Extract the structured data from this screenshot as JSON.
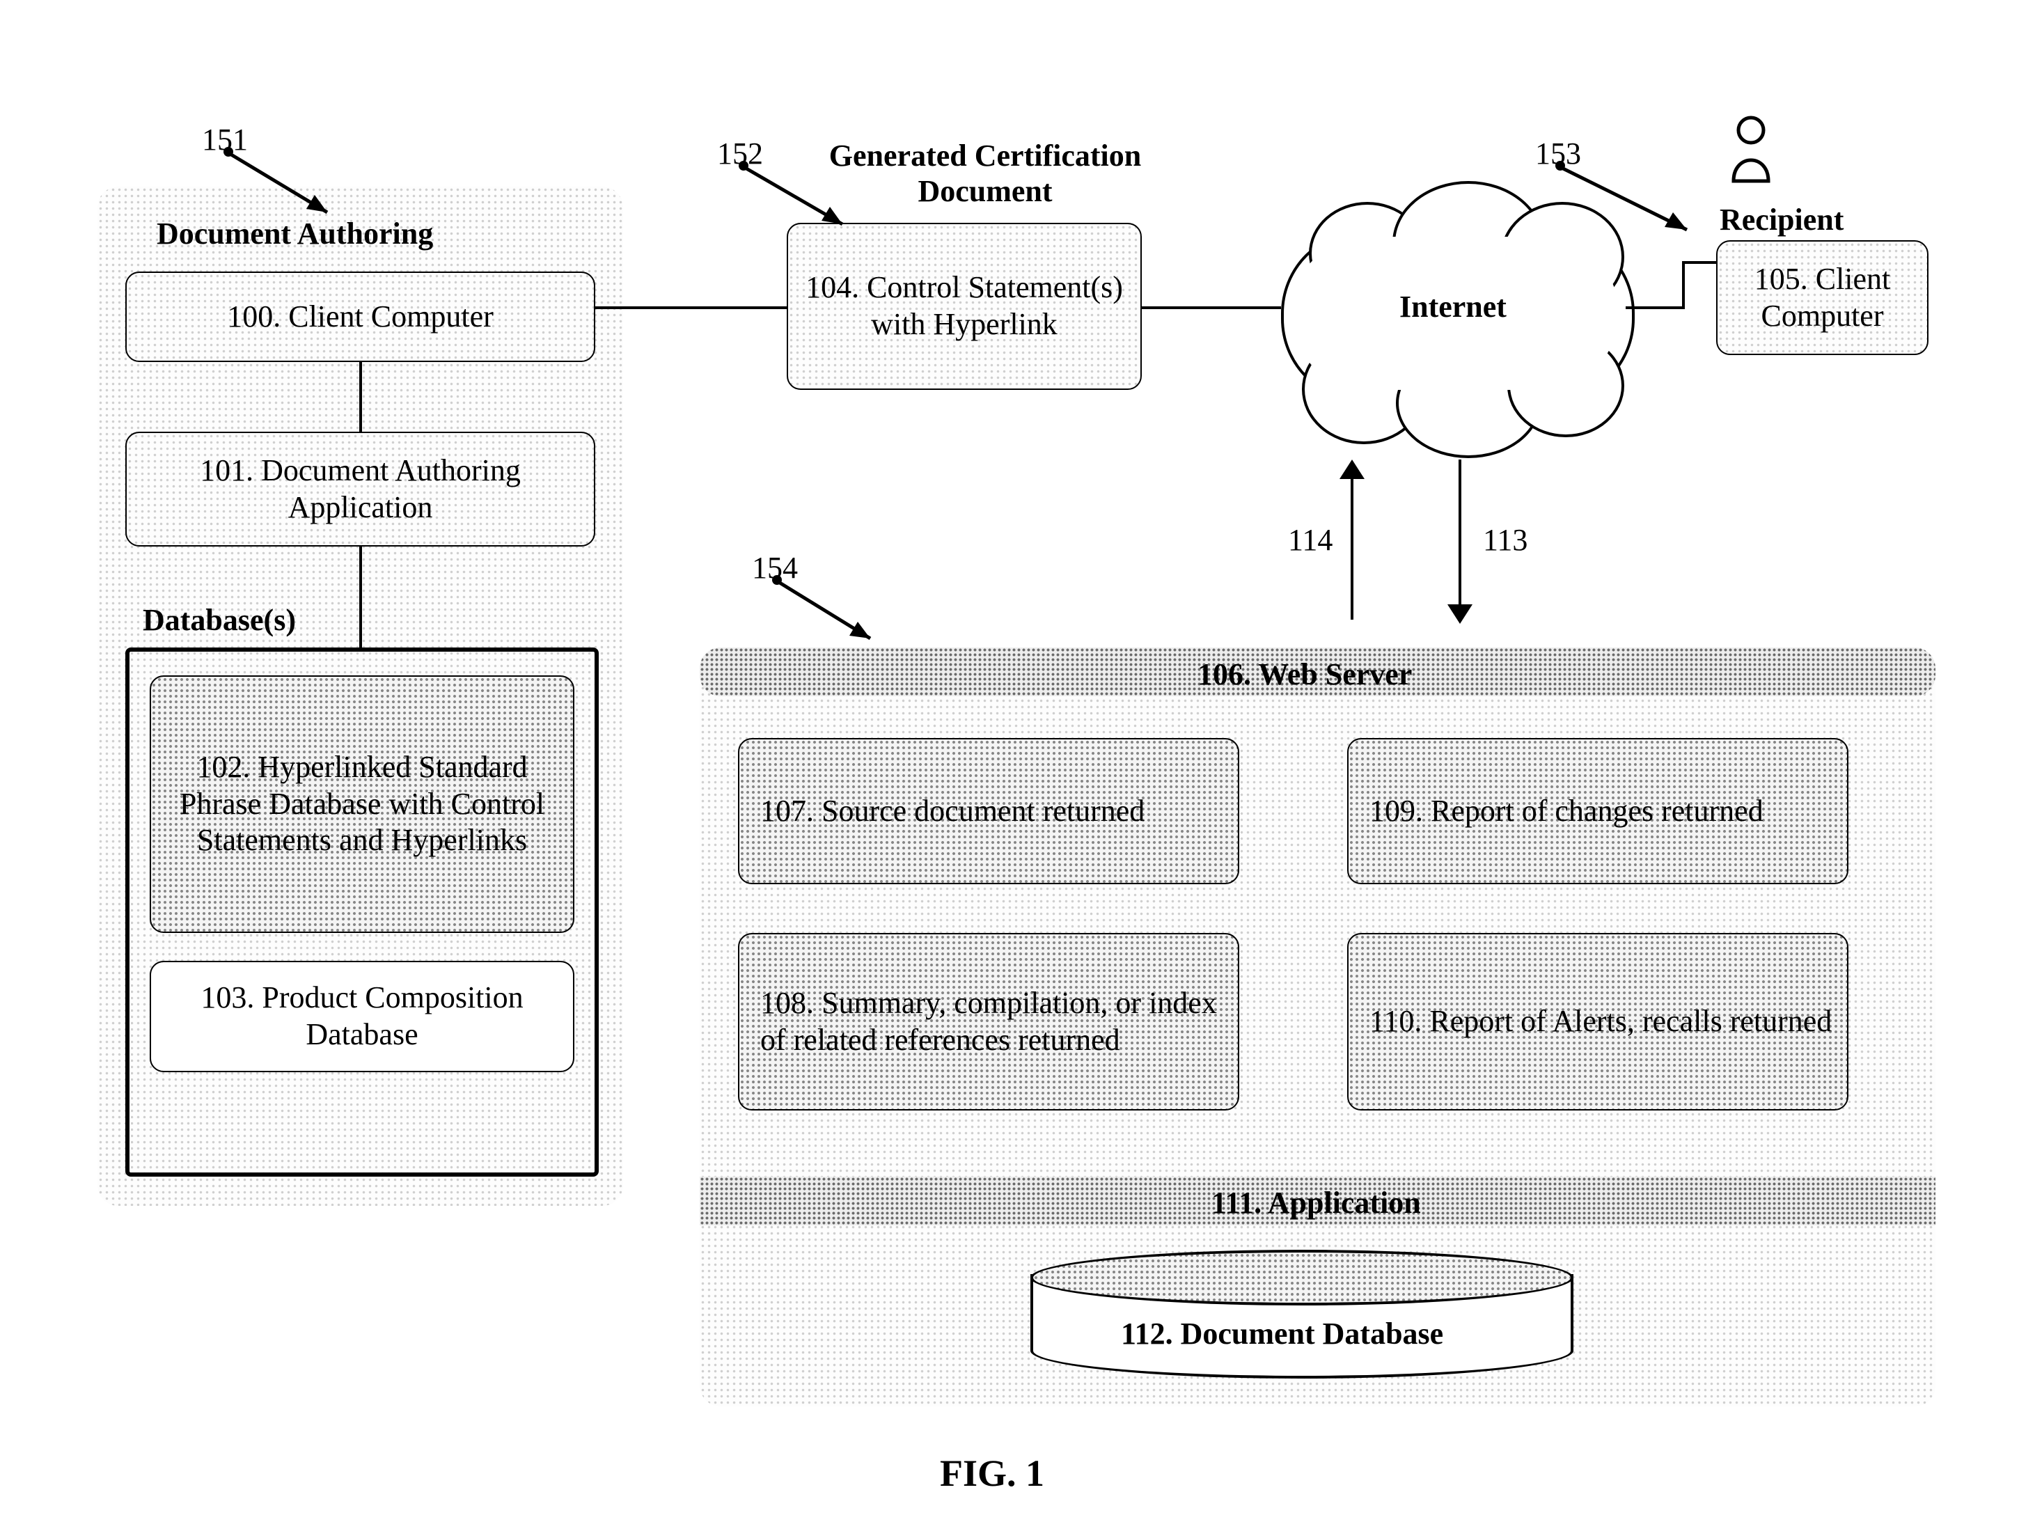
{
  "figure_caption": "FIG. 1",
  "refs": {
    "r151": "151",
    "r152": "152",
    "r153": "153",
    "r154": "154",
    "r113": "113",
    "r114": "114"
  },
  "authoring": {
    "title": "Document Authoring",
    "n100": "100.  Client Computer",
    "n101": "101.  Document Authoring\nApplication",
    "db_title": "Database(s)",
    "n102": "102.  Hyperlinked Standard\nPhrase Database with\nControl Statements and\nHyperlinks",
    "n103": "103.  Product Composition\nDatabase"
  },
  "cert_doc": {
    "title": "Generated Certification\nDocument",
    "n104": "104.   Control\nStatement(s) with\nHyperlink"
  },
  "internet": "Internet",
  "recipient": {
    "title": "Recipient",
    "n105": "105.  Client\nComputer"
  },
  "server": {
    "n106": "106.  Web Server",
    "n107": "107.  Source document returned",
    "n108": "108.  Summary, compilation, or\nindex of related references\nreturned",
    "n109": "109.  Report of changes\nreturned",
    "n110": "110.  Report of Alerts, recalls\nreturned",
    "n111": "111.  Application",
    "n112": "112.  Document Database"
  }
}
